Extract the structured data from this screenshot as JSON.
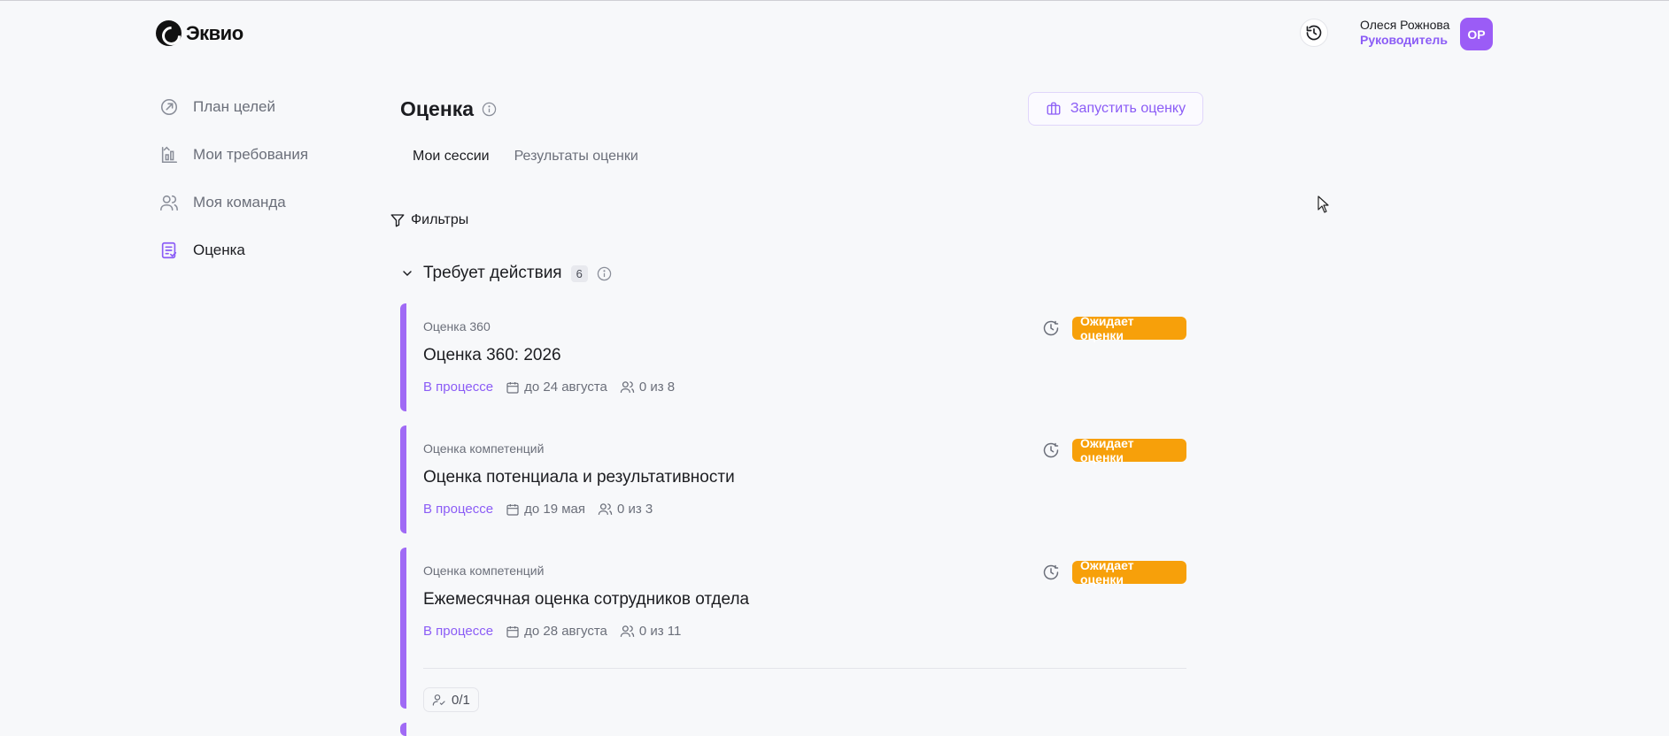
{
  "app": {
    "logo_text": "Эквио"
  },
  "user": {
    "name": "Олеся Рожнова",
    "role": "Руководитель",
    "initials": "ОР"
  },
  "sidebar": {
    "items": [
      {
        "label": "План целей",
        "icon": "target-arrow-icon",
        "active": false
      },
      {
        "label": "Мои требования",
        "icon": "chart-requirements-icon",
        "active": false
      },
      {
        "label": "Моя команда",
        "icon": "team-icon",
        "active": false
      },
      {
        "label": "Оценка",
        "icon": "assessment-doc-icon",
        "active": true
      }
    ]
  },
  "main": {
    "title": "Оценка",
    "launch_label": "Запустить оценку",
    "tabs": [
      {
        "label": "Мои сессии",
        "active": true
      },
      {
        "label": "Результаты оценки",
        "active": false
      }
    ],
    "filters_label": "Фильтры",
    "group": {
      "title": "Требует действия",
      "count": "6"
    },
    "cards": [
      {
        "type": "Оценка 360",
        "title": "Оценка 360: 2026",
        "status": "В процессе",
        "deadline": "до 24 августа",
        "participants": "0 из 8",
        "badge": "Ожидает оценки"
      },
      {
        "type": "Оценка компетенций",
        "title": "Оценка потенциала и результативности",
        "status": "В процессе",
        "deadline": "до 19 мая",
        "participants": "0 из 3",
        "badge": "Ожидает оценки"
      },
      {
        "type": "Оценка компетенций",
        "title": "Ежемесячная оценка сотрудников отдела",
        "status": "В процессе",
        "deadline": "до 28 августа",
        "participants": "0 из 11",
        "badge": "Ожидает оценки",
        "progress": "0/1"
      }
    ]
  },
  "colors": {
    "accent": "#8b5cf6",
    "badge": "#f7a00a",
    "background": "#f7f8fa"
  }
}
